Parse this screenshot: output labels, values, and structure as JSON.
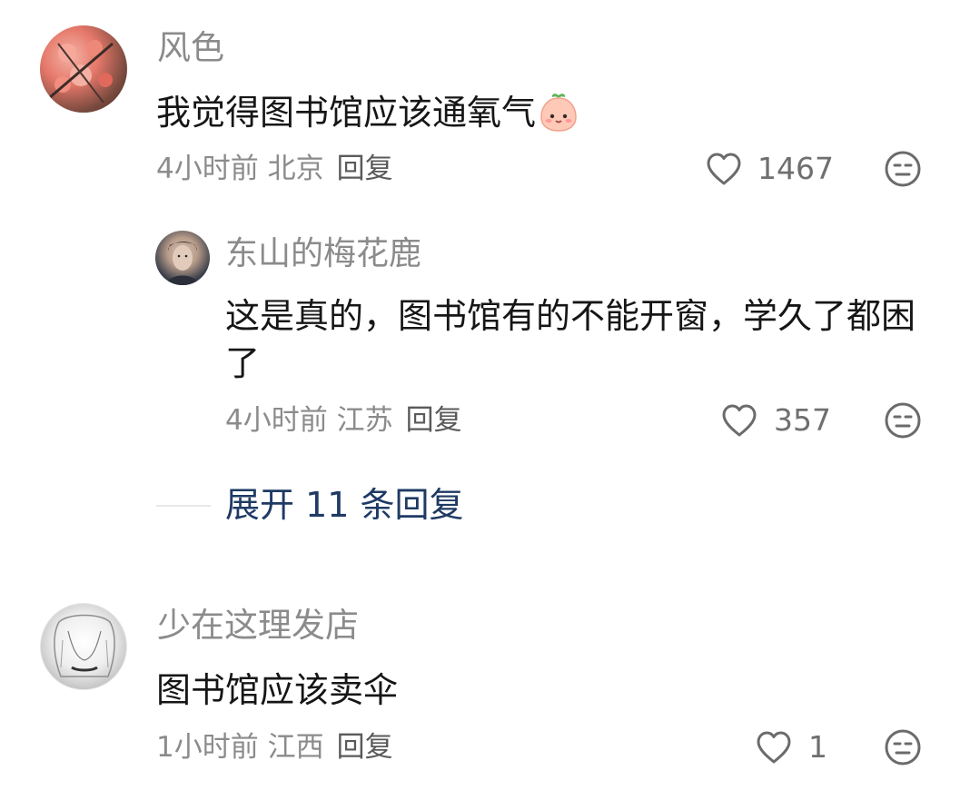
{
  "comments": [
    {
      "username": "风色",
      "content": "我觉得图书馆应该通氧气",
      "emoji_icon": "peach-emoji-icon",
      "time": "4小时前",
      "location": "北京",
      "reply_label": "回复",
      "likes": "1467",
      "replies": [
        {
          "username": "东山的梅花鹿",
          "content": "这是真的，图书馆有的不能开窗，学久了都困了",
          "time": "4小时前",
          "location": "江苏",
          "reply_label": "回复",
          "likes": "357"
        }
      ],
      "expand_label": "展开 11 条回复"
    },
    {
      "username": "少在这理发店",
      "content": "图书馆应该卖伞",
      "time": "1小时前",
      "location": "江西",
      "reply_label": "回复",
      "likes": "1"
    }
  ],
  "colors": {
    "username": "#8b8b8b",
    "content": "#161616",
    "expand_link": "#1f3a64",
    "icon_stroke": "#6b6b6b"
  }
}
